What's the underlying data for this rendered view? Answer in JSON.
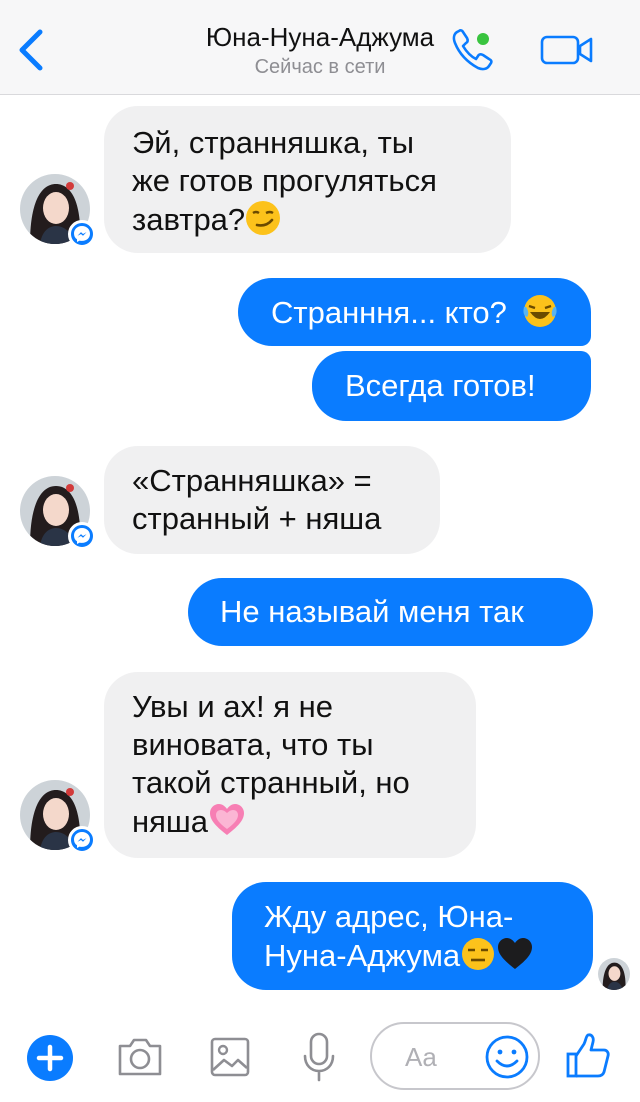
{
  "header": {
    "contact_name": "Юна-Нуна-Аджума",
    "status": "Сейчас в сети",
    "accent": "#0a7cff",
    "online_dot": "#39c43f"
  },
  "messages": [
    {
      "from": "them",
      "lines": [
        "Эй, странняшка, ты",
        "же готов прогуляться",
        "завтра?"
      ],
      "emoji": "smirk"
    },
    {
      "from": "me",
      "lines": [
        "Странння... кто?"
      ],
      "emoji": "laugh-tears"
    },
    {
      "from": "me",
      "lines": [
        "Всегда готов!"
      ]
    },
    {
      "from": "them",
      "lines": [
        "«Странняшка» =",
        "странный + няша"
      ]
    },
    {
      "from": "me",
      "lines": [
        "Не называй меня так"
      ]
    },
    {
      "from": "them",
      "lines": [
        "Увы и ах! я не",
        "виновата, что ты",
        "такой странный, но",
        "няша"
      ],
      "emoji": "pink-heart"
    },
    {
      "from": "me",
      "lines": [
        "Жду адрес, Юна-",
        "Нуна-Аджума"
      ],
      "emoji": "expressionless-black-heart"
    }
  ],
  "composer": {
    "placeholder": "Aa"
  },
  "colors": {
    "incoming_bubble": "#f0f0f1",
    "outgoing_bubble": "#0a7cff"
  }
}
